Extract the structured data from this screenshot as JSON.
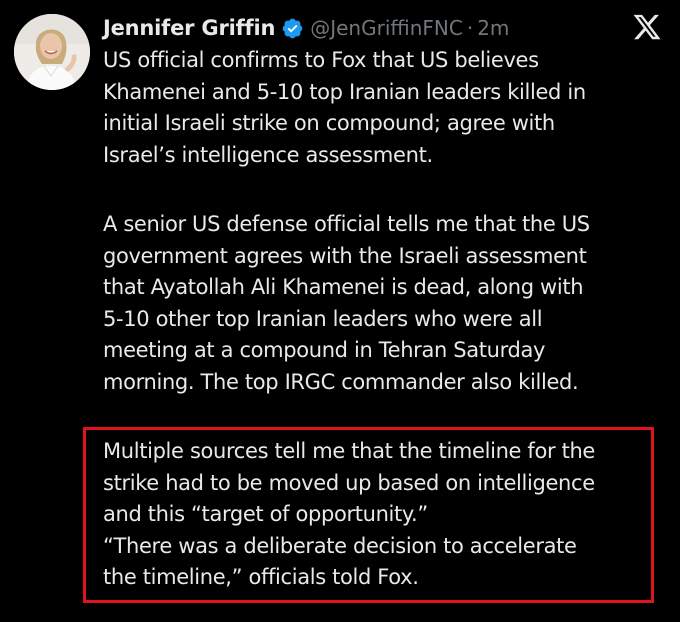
{
  "tweet": {
    "author_name": "Jennifer Griffin",
    "handle": "@JenGriffinFNC",
    "separator": "·",
    "time": "2m",
    "paragraphs": [
      "US official confirms to Fox that US believes\nKhamenei and 5-10 top Iranian leaders killed in\ninitial Israeli strike on compound; agree with\nIsrael’s intelligence assessment.",
      "A senior US defense official tells me that the US\ngovernment agrees with the Israeli assessment\nthat Ayatollah Ali Khamenei is dead, along with\n5-10 other top Iranian leaders who were all\nmeeting at a compound in Tehran Saturday\nmorning. The top IRGC commander also killed.",
      "Multiple sources tell me that the timeline for the\nstrike had to be moved up based on intelligence\nand this “target of opportunity.”\n“There was a deliberate decision to accelerate\nthe timeline,” officials told Fox."
    ]
  },
  "icons": {
    "verified": "verified-badge-icon",
    "platform": "x-logo-icon"
  },
  "colors": {
    "background": "#000000",
    "text": "#e7e9ea",
    "secondary_text": "#71767b",
    "verified_blue": "#1d9bf0",
    "highlight_border": "#e0141e"
  }
}
